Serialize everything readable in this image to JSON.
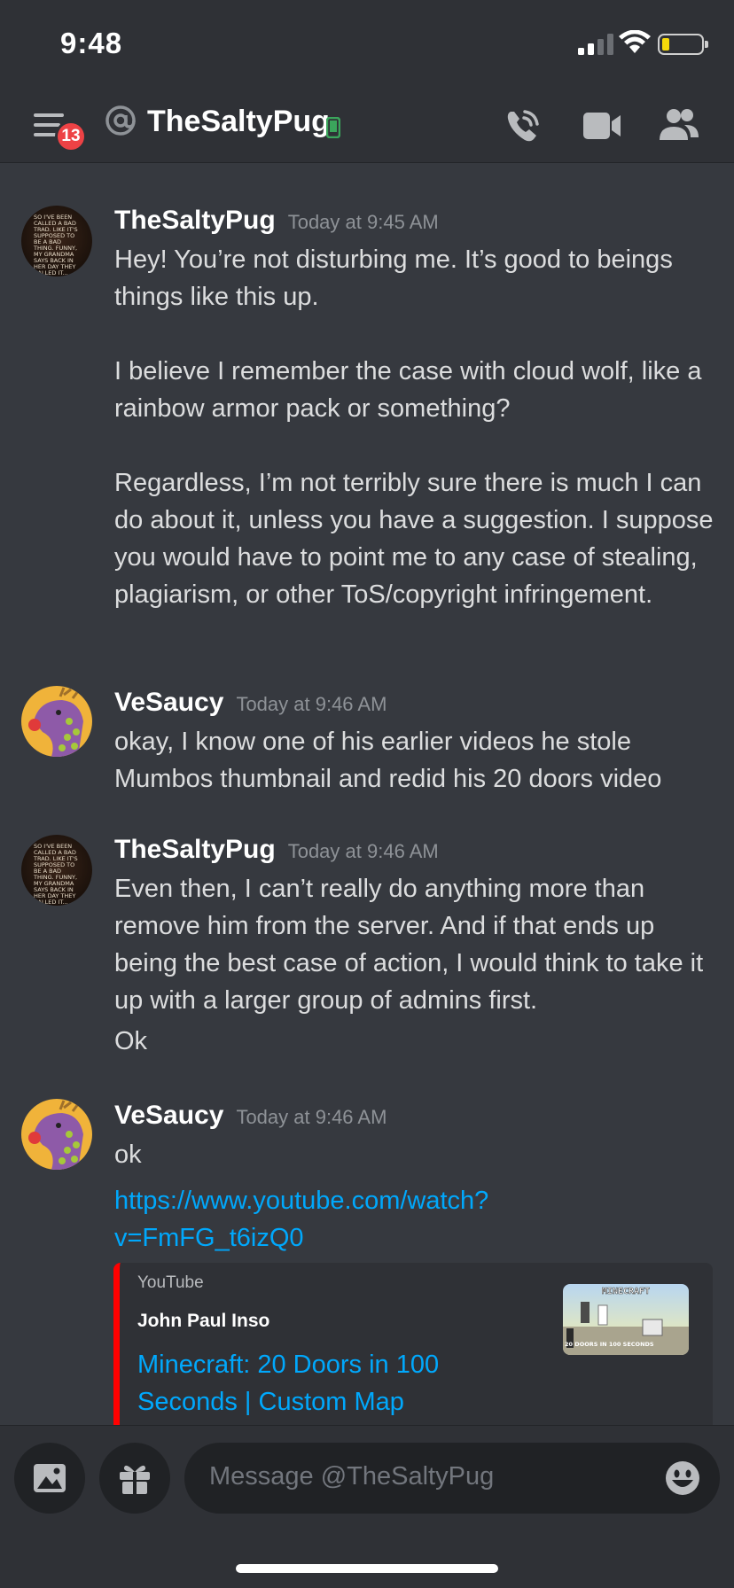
{
  "status_bar": {
    "time": "9:48"
  },
  "header": {
    "badge_count": "13",
    "channel_name": "TheSaltyPug"
  },
  "messages": [
    {
      "author": "TheSaltyPug",
      "timestamp": "Today at 9:45 AM",
      "avatar_text": "SO I'VE BEEN CALLED A BAD TRAD. LIKE IT'S SUPPOSED TO BE A BAD THING. FUNNY, MY GRANDMA SAYS BACK IN HER DAY THEY CALLED IT... CATHOLIC.",
      "paragraphs": [
        "Hey! You’re not disturbing me. It’s good to beings things like this up.",
        "",
        "I believe I remember the case with cloud wolf, like a rainbow armor pack or something?",
        "",
        "Regardless, I’m not terribly sure there is much I can do about it, unless you have a suggestion. I suppose you would have to point me to any case of stealing, plagiarism, or other ToS/copyright infringement."
      ]
    },
    {
      "author": "VeSaucy",
      "timestamp": "Today at 9:46 AM",
      "paragraphs": [
        "okay, I know one of his earlier videos he stole Mumbos thumbnail and redid his 20 doors video"
      ]
    },
    {
      "author": "TheSaltyPug",
      "timestamp": "Today at 9:46 AM",
      "avatar_text": "SO I'VE BEEN CALLED A BAD TRAD. LIKE IT'S SUPPOSED TO BE A BAD THING. FUNNY, MY GRANDMA SAYS BACK IN HER DAY THEY CALLED IT... CATHOLIC.",
      "paragraphs": [
        "Even then, I can’t really do anything more than remove him from the server. And if that ends up being the best case of action, I would think to take it up with a larger group of admins first.",
        "Ok"
      ]
    },
    {
      "author": "VeSaucy",
      "timestamp": "Today at 9:46 AM",
      "paragraphs": [
        "ok"
      ],
      "link_line1": "https://www.youtube.com/watch?",
      "link_line2": "v=FmFG_t6izQ0"
    }
  ],
  "embed": {
    "provider": "YouTube",
    "author": "John Paul Inso",
    "title": "Minecraft: 20 Doors in 100 Seconds | Custom Map",
    "thumb_caption_top": "MINECRAFT",
    "thumb_caption_bottom": "20 DOORS IN 100 SECONDS",
    "accent": "#ff0000"
  },
  "composer": {
    "placeholder": "Message @TheSaltyPug"
  },
  "colors": {
    "background": "#36393f",
    "header": "#2f3136",
    "link": "#00a8fc",
    "badge": "#ed4245",
    "online_mobile": "#3ba55c"
  }
}
